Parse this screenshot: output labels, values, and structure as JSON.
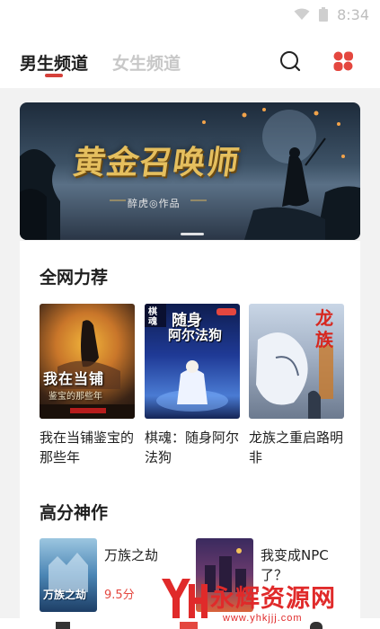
{
  "status_bar": {
    "time": "8:34",
    "icons": [
      "wifi-icon",
      "battery-icon"
    ]
  },
  "header": {
    "tabs": [
      {
        "label": "男生频道",
        "active": true
      },
      {
        "label": "女生频道",
        "active": false
      }
    ],
    "icons": [
      "search-icon",
      "category-icon"
    ],
    "accent_color": "#d5403a"
  },
  "banner": {
    "title": "黄金召唤师",
    "author": "醉虎◎作品"
  },
  "sections": {
    "recommend": {
      "title": "全网力荐",
      "books": [
        {
          "name": "我在当铺鉴宝的那些年",
          "cover_title": "我在当铺",
          "cover_subtitle": "鉴宝的那些年"
        },
        {
          "name": "棋魂：随身阿尔法狗",
          "cover_title": "随身",
          "cover_subtitle": "阿尔法狗",
          "cover_tag": "棋魂"
        },
        {
          "name": "龙族之重启路明非",
          "cover_title": "龙族"
        }
      ]
    },
    "top_rated": {
      "title": "高分神作",
      "books": [
        {
          "name": "万族之劫",
          "score": "9.5分",
          "cover_title": "万族之劫"
        },
        {
          "name": "我变成NPC了？"
        }
      ]
    }
  },
  "watermark": {
    "logo_text": "YH",
    "main": "永辉资源网",
    "url": "www.yhkjjj.com"
  },
  "colors": {
    "score": "#e4473f",
    "watermark": "#e02a2a"
  }
}
